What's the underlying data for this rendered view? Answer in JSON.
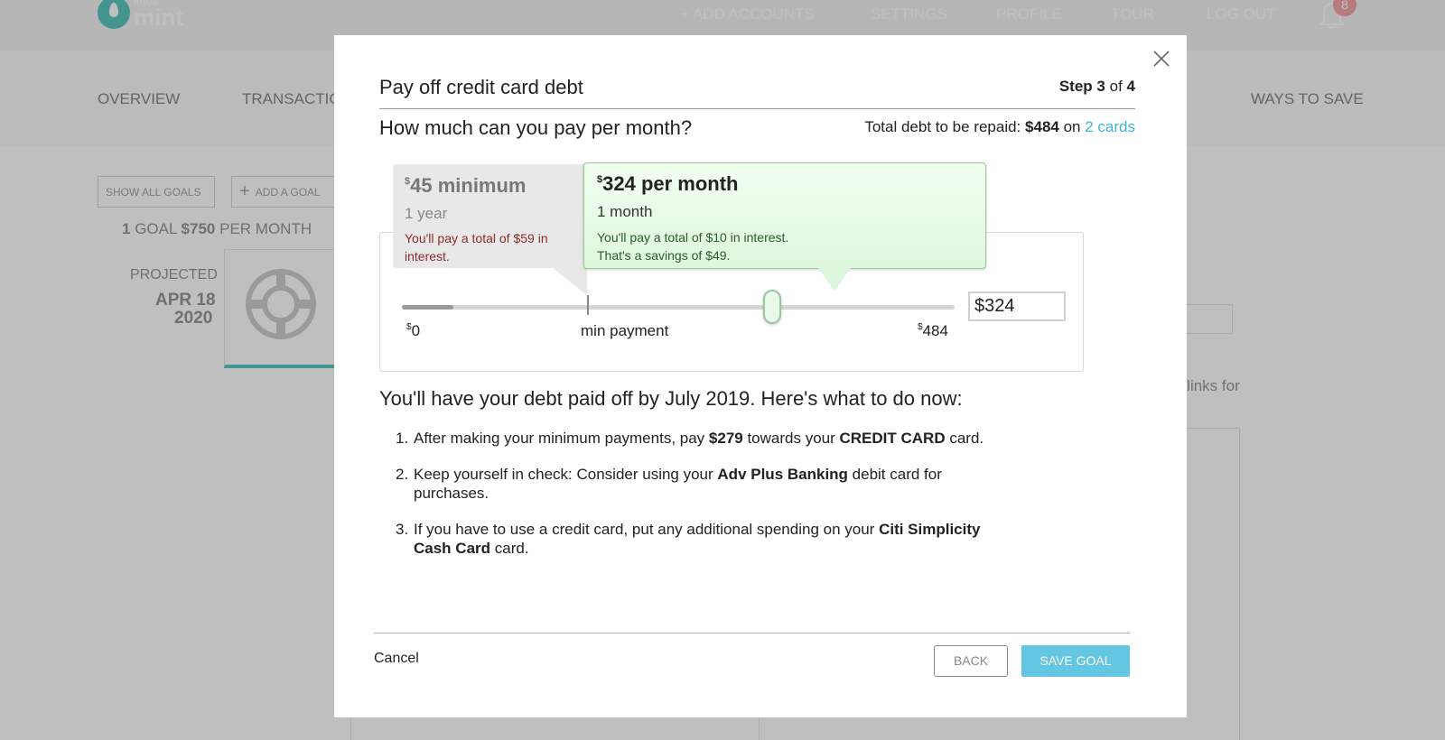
{
  "app": {
    "logo_small": "intuit",
    "logo_big": "mint",
    "nav": [
      "+ ADD ACCOUNTS",
      "SETTINGS",
      "PROFILE",
      "TOUR",
      "LOG OUT"
    ],
    "notification_count": "8",
    "subnav": [
      "OVERVIEW",
      "TRANSACTIO",
      "WAYS TO SAVE"
    ]
  },
  "background": {
    "show_all_goals": "SHOW ALL GOALS",
    "add_goal": "ADD A GOAL",
    "goal_summary_count": "1",
    "goal_summary_text": "GOAL",
    "goal_summary_amount": "$750",
    "goal_summary_suffix": "PER MONTH",
    "projected_label": "PROJECTED",
    "projected_date_1": "APR 18",
    "projected_date_2": "2020",
    "links_fragment": "d links for"
  },
  "modal": {
    "title": "Pay off credit card debt",
    "step_word": "Step",
    "step_current": "3",
    "step_of": "of",
    "step_total": "4",
    "question": "How much can you pay per month?",
    "total_debt_label": "Total debt to be repaid:",
    "total_debt_amount": "$484",
    "total_debt_on": "on",
    "cards_link": "2 cards",
    "min_option": {
      "currency": "$",
      "amount": "45 minimum",
      "duration": "1 year",
      "note": "You'll pay a total of $59 in interest."
    },
    "selected_option": {
      "currency": "$",
      "amount": "324 per month",
      "duration": "1 month",
      "note_line1": "You'll pay a total of $10 in interest.",
      "note_line2": "That's a savings of $49."
    },
    "slider": {
      "min_label_currency": "$",
      "min_label": "0",
      "mid_label": "min payment",
      "max_label_currency": "$",
      "max_label": "484",
      "min_value": 0,
      "max_value": 484,
      "min_payment_value": 45,
      "value": 324,
      "input_value": "$324"
    },
    "result": "You'll have your debt paid off by July 2019. Here's what to do now:",
    "steps": [
      {
        "num": "1.",
        "t1": "After making your minimum payments, pay ",
        "b1": "$279",
        "t2": " towards your ",
        "b2": "CREDIT CARD",
        "t3": " card."
      },
      {
        "num": "2.",
        "t1": "Keep yourself in check: Consider using your ",
        "b1": "Adv Plus Banking",
        "t2": " debit card for purchases."
      },
      {
        "num": "3.",
        "t1": "If you have to use a credit card, put any additional spending on your ",
        "b1": "Citi Simplicity Cash Card",
        "t2": " card."
      }
    ],
    "cancel": "Cancel",
    "back": "BACK",
    "save": "SAVE GOAL"
  }
}
